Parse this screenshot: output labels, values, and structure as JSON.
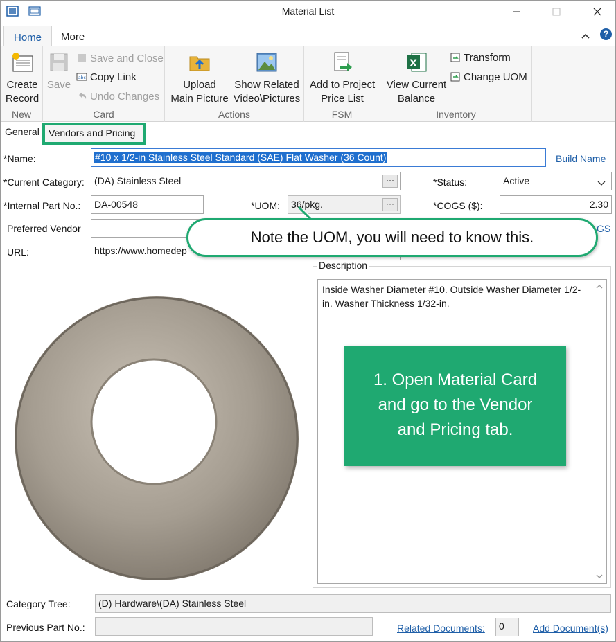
{
  "window": {
    "title": "Material List"
  },
  "ribbon_tabs": [
    "Home",
    "More"
  ],
  "ribbon": {
    "new": {
      "label": "New",
      "create_record": [
        "Create",
        "Record"
      ]
    },
    "card": {
      "label": "Card",
      "save": "Save",
      "save_and_close": "Save and Close",
      "copy_link": "Copy Link",
      "undo_changes": "Undo Changes"
    },
    "actions": {
      "label": "Actions",
      "upload_main_picture": [
        "Upload",
        "Main Picture"
      ],
      "show_related": [
        "Show Related",
        "Video\\Pictures"
      ]
    },
    "fsm": {
      "label": "FSM",
      "add_to_project": [
        "Add to Project",
        "Price List"
      ]
    },
    "inventory": {
      "label": "Inventory",
      "view_current_balance": [
        "View Current",
        "Balance"
      ],
      "transform": "Transform",
      "change_uom": "Change UOM"
    }
  },
  "form_tabs": {
    "general": "General",
    "vendors_and_pricing": "Vendors and Pricing"
  },
  "form": {
    "name_label": "*Name:",
    "name_value": "#10 x 1/2-in Stainless Steel Standard (SAE) Flat Washer (36 Count)",
    "build_name": "Build Name",
    "category_label": "*Current Category:",
    "category_value": "(DA) Stainless Steel",
    "status_label": "*Status:",
    "status_value": "Active",
    "part_no_label": "*Internal Part No.:",
    "part_no_value": "DA-00548",
    "uom_label": "*UOM:",
    "uom_value": "36/pkg.",
    "cogs_label": "*COGS ($):",
    "cogs_value": "2.30",
    "preferred_vendor_label": "Preferred Vendor",
    "preferred_vendor_value": "",
    "cogs_link_partial": "GS",
    "url_label": "URL:",
    "url_value": "https://www.homedep",
    "description_label": "Description",
    "description_value": "Inside Washer Diameter #10.  Outside Washer Diameter 1/2-in.    Washer Thickness 1/32-in.",
    "category_tree_label": "Category Tree:",
    "category_tree_value": "(D) Hardware\\(DA) Stainless Steel",
    "previous_part_label": "Previous Part No.:",
    "previous_part_value": "",
    "related_documents": "Related Documents:",
    "related_documents_count": "0",
    "add_documents": "Add Document(s)"
  },
  "callouts": {
    "uom_note": "Note the UOM, you will need to know this.",
    "step1_lines": [
      "1. Open Material Card",
      "and go to the Vendor",
      "and Pricing tab."
    ]
  },
  "colors": {
    "accent_green": "#1fa971",
    "link_blue": "#1f5fa8",
    "selection_blue": "#1f6fce"
  },
  "icons": [
    "app-menu-icon",
    "form-icon",
    "minimize-icon",
    "maximize-icon",
    "close-icon",
    "collapse-ribbon-icon",
    "help-icon",
    "create-record-icon",
    "save-icon",
    "save-close-icon",
    "copy-link-icon",
    "undo-icon",
    "upload-folder-icon",
    "pictures-icon",
    "add-to-price-list-icon",
    "excel-icon",
    "transform-icon",
    "change-uom-icon",
    "washer-image"
  ]
}
